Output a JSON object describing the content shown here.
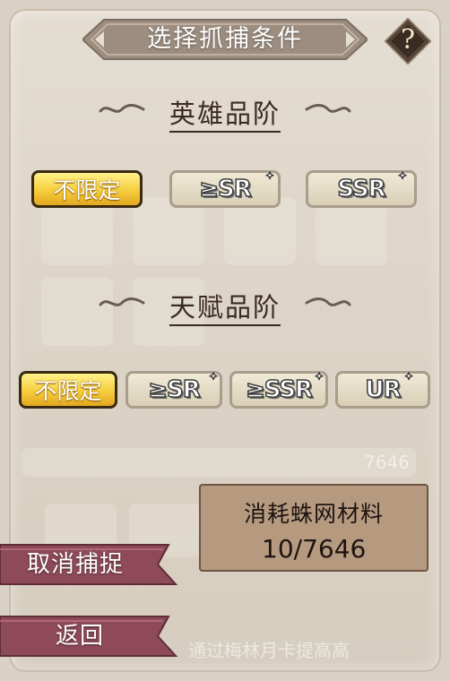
{
  "title": "选择抓捕条件",
  "help_icon": "?",
  "hero_grade": {
    "title": "英雄品阶",
    "options": [
      {
        "label": "不限定",
        "selected": true
      },
      {
        "label": "≥SR",
        "selected": false
      },
      {
        "label": "SSR",
        "selected": false
      }
    ]
  },
  "talent_grade": {
    "title": "天赋品阶",
    "options": [
      {
        "label": "不限定",
        "selected": true
      },
      {
        "label": "≥SR",
        "selected": false
      },
      {
        "label": "≥SSR",
        "selected": false
      },
      {
        "label": "UR",
        "selected": false
      }
    ]
  },
  "cost": {
    "label": "消耗蛛网材料",
    "value": "10/7646"
  },
  "buttons": {
    "cancel_capture": "取消捕捉",
    "back": "返回"
  },
  "background_text": {
    "count": "7646",
    "hint": "通过梅林月卡提高高"
  },
  "colors": {
    "selected_gold": "#f6cd3d",
    "ribbon": "#8e4a59",
    "cost_box": "#b59a80",
    "title_bar": "#9c8d7f"
  }
}
